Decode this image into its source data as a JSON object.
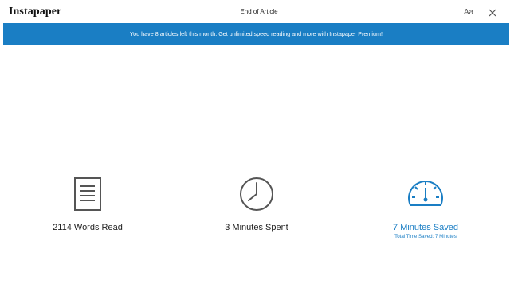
{
  "header": {
    "logo": "Instapaper",
    "title": "End of Article",
    "font_button_label": "Aa",
    "close_icon": "close-icon"
  },
  "banner": {
    "text_before": "You have 8 articles left this month. Get unlimited speed reading and more with ",
    "link_text": "Instapaper Premium",
    "text_after": "!",
    "background_color": "#1a7ec4"
  },
  "stats": {
    "words": {
      "icon": "document-icon",
      "label": "2114 Words Read"
    },
    "minutes": {
      "icon": "clock-icon",
      "label": "3 Minutes Spent"
    },
    "saved": {
      "icon": "speedometer-icon",
      "label": "7 Minutes Saved",
      "sublabel": "Total Time Saved: 7 Minutes",
      "accent_color": "#1a7ec4"
    }
  }
}
